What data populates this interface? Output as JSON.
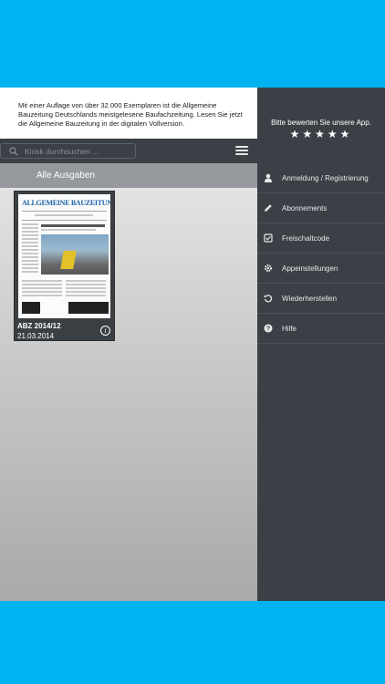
{
  "info": {
    "text": "Mit einer Auflage von über 32.000 Exemplaren ist die Allgemeine Bauzeitung Deutschlands meistgelesene Baufachzeitung. Lesen Sie jetzt die Allgemeine Bauzeitung in der digitalen Vollversion."
  },
  "search": {
    "placeholder": "Kiosk durchsuchen ..."
  },
  "section": {
    "title": "Alle Ausgaben"
  },
  "issues": [
    {
      "name": "ABZ 2014/12",
      "date": "21.03.2014",
      "masthead": "ALLGEMEINE BAUZEITUNG"
    }
  ],
  "side": {
    "rate_text": "Bitte bewerten Sie unsere App.",
    "stars": "★★★★★",
    "items": [
      {
        "label": "Anmeldung / Registrierung",
        "icon": "user-icon"
      },
      {
        "label": "Abonnements",
        "icon": "pencil-icon"
      },
      {
        "label": "Freischaltcode",
        "icon": "checkbox-icon"
      },
      {
        "label": "Appeinstellungen",
        "icon": "gear-icon"
      },
      {
        "label": "Wiederherstellen",
        "icon": "restore-icon"
      },
      {
        "label": "Hilfe",
        "icon": "help-icon"
      }
    ]
  },
  "colors": {
    "background": "#00b3f0",
    "panel": "#3a4046",
    "section": "#95999d"
  }
}
